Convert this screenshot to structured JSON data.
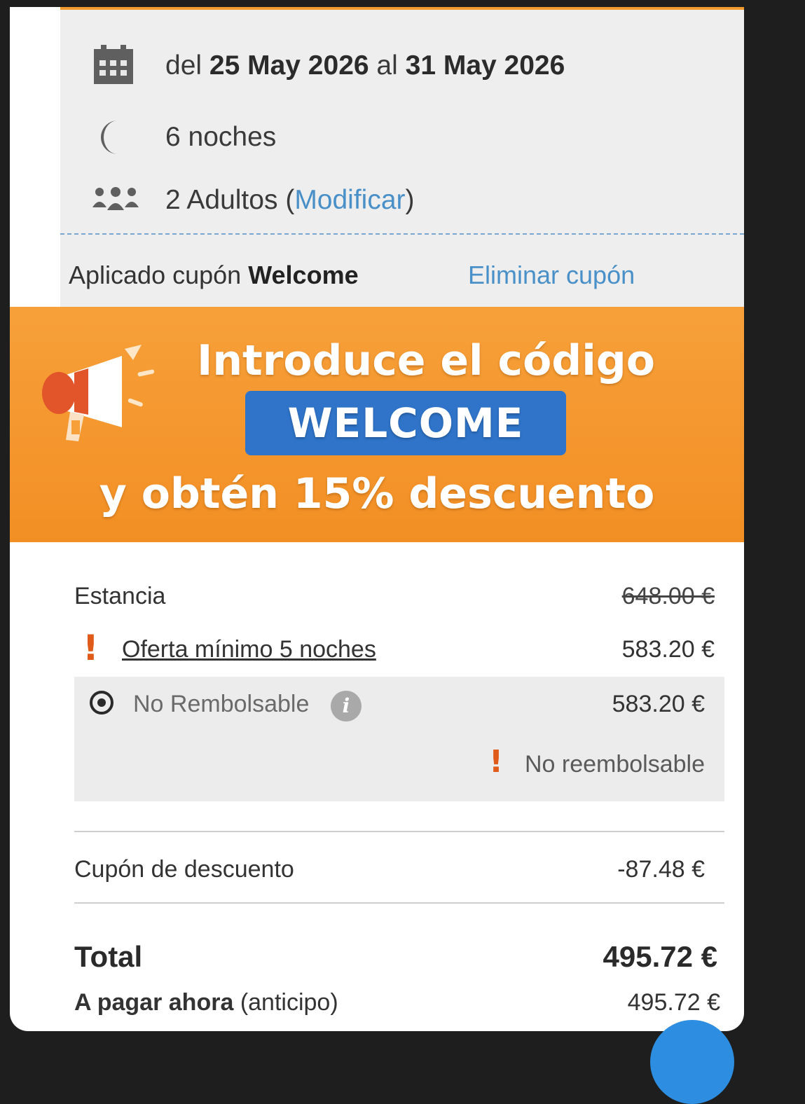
{
  "summary": {
    "dates_prefix": "del",
    "date_from": "25 May 2026",
    "dates_mid": "al",
    "date_to": "31 May 2026",
    "nights": "6 noches",
    "adults": "2 Adultos",
    "adults_open": "(",
    "modify_label": "Modificar",
    "adults_close": ")"
  },
  "coupon": {
    "applied_prefix": "Aplicado cupón",
    "code": "Welcome",
    "remove_label": "Eliminar cupón"
  },
  "banner": {
    "line1": "Introduce el código",
    "code": "WELCOME",
    "line3": "y obtén 15% descuento"
  },
  "pricing": {
    "stay_label": "Estancia",
    "stay_original": "648.00 €",
    "offer_label": "Oferta mínimo 5 noches",
    "offer_price": "583.20 €",
    "rate_label": "No Rembolsable",
    "rate_price": "583.20 €",
    "rate_note": "No reembolsable",
    "coupon_label": "Cupón de descuento",
    "coupon_value": "-87.48 €",
    "total_label": "Total",
    "total_value": "495.72 €",
    "pay_now_label": "A pagar ahora",
    "pay_now_note": "(anticipo)",
    "pay_now_value": "495.72 €"
  },
  "colors": {
    "banner_orange": "#f39a2e",
    "code_blue": "#2f74c9",
    "link_blue": "#4a90c8",
    "warning_orange": "#e05a1a"
  },
  "icons": [
    "calendar-icon",
    "moon-icon",
    "people-icon",
    "megaphone-icon",
    "warning-icon",
    "info-icon",
    "radio-selected-icon"
  ]
}
